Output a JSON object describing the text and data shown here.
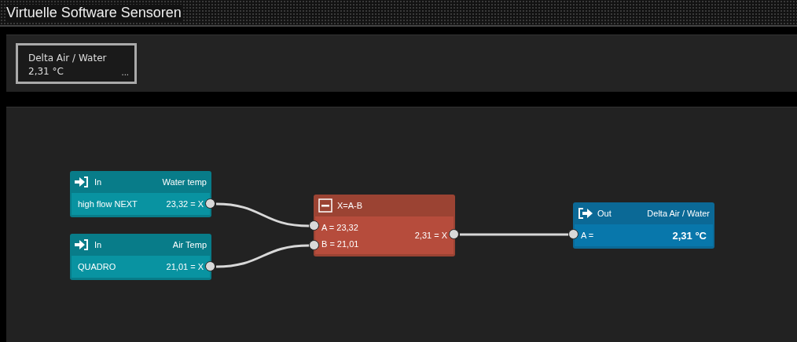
{
  "title": "Virtuelle Software Sensoren",
  "sensor_tile": {
    "name": "Delta Air / Water",
    "value": "2,31 °C",
    "menu": "..."
  },
  "nodes": [
    {
      "kind": "input",
      "type_label": "In",
      "name": "Water temp",
      "source": "high flow NEXT",
      "output": "23,32 = X"
    },
    {
      "kind": "input",
      "type_label": "In",
      "name": "Air Temp",
      "source": "QUADRO",
      "output": "21,01 = X"
    },
    {
      "kind": "math",
      "formula": "X=A-B",
      "inputs": [
        "A = 23,32",
        "B = 21,01"
      ],
      "output": "2,31 = X"
    },
    {
      "kind": "output",
      "type_label": "Out",
      "name": "Delta Air / Water",
      "input": "A =",
      "value": "2,31 °C"
    }
  ]
}
